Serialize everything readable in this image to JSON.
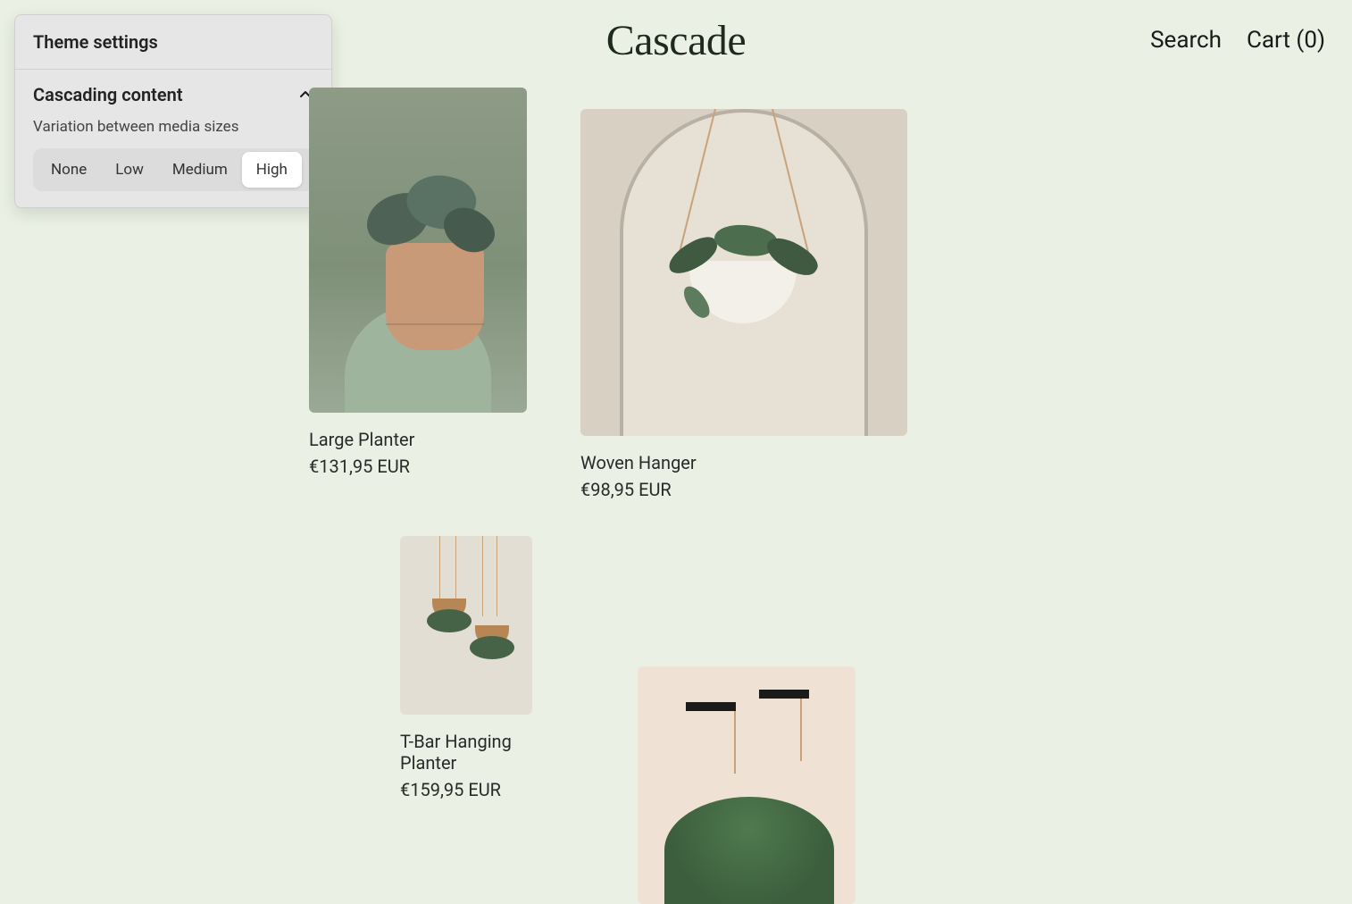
{
  "header": {
    "brand": "Cascade",
    "search_label": "Search",
    "cart_label": "Cart (0)"
  },
  "settings": {
    "panel_title": "Theme settings",
    "section_title": "Cascading content",
    "section_sub": "Variation between media sizes",
    "options": [
      "None",
      "Low",
      "Medium",
      "High"
    ],
    "selected_index": 3
  },
  "products": [
    {
      "title": "Large Planter",
      "price": "€131,95 EUR"
    },
    {
      "title": "Woven Hanger",
      "price": "€98,95 EUR"
    },
    {
      "title": "T-Bar Hanging Planter",
      "price": "€159,95 EUR"
    },
    {
      "title": "",
      "price": ""
    }
  ]
}
